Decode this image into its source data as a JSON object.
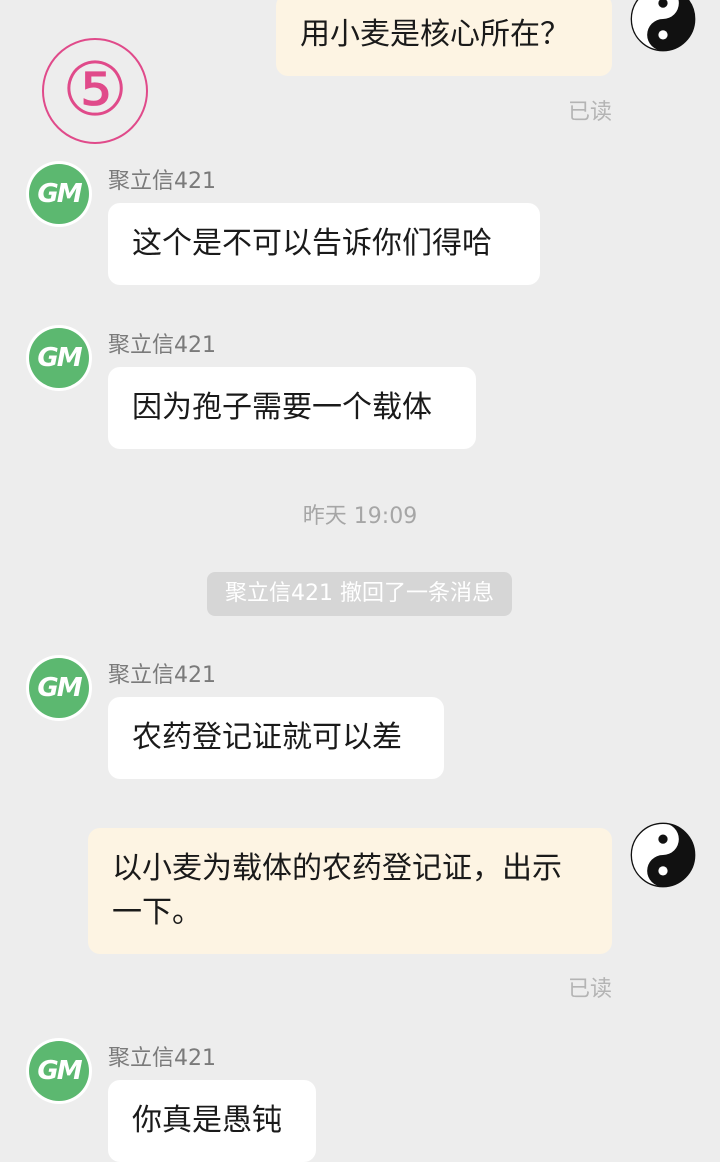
{
  "badge": "⑤",
  "timestamp": "昨天 19:09",
  "recall_notice": "聚立信421 撤回了一条消息",
  "avatar_text": "GM",
  "messages": [
    {
      "side": "out",
      "text": "用小麦是核心所在？",
      "status": "已读"
    },
    {
      "side": "in",
      "sender": "聚立信421",
      "text": "这个是不可以告诉你们得哈"
    },
    {
      "side": "in",
      "sender": "聚立信421",
      "text": "因为孢子需要一个载体"
    },
    {
      "side": "in",
      "sender": "聚立信421",
      "text": "农药登记证就可以差"
    },
    {
      "side": "out",
      "text": "以小麦为载体的农药登记证，出示一下。",
      "status": "已读"
    },
    {
      "side": "in",
      "sender": "聚立信421",
      "text": "你真是愚钝"
    }
  ],
  "colors": {
    "background": "#ededed",
    "incoming_bubble": "#ffffff",
    "outgoing_bubble": "#fdf4e3",
    "avatar_green": "#5cb870",
    "badge_pink": "#e04a8a"
  },
  "icons": {
    "contact_avatar": "gm-logo-icon",
    "self_avatar": "yin-yang-icon"
  }
}
